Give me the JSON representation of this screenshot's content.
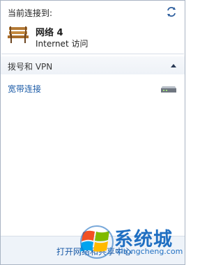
{
  "header": {
    "label": "当前连接到:",
    "refresh_icon": "refresh-icon"
  },
  "current_network": {
    "icon": "park-bench-network-icon",
    "name": "网络  4",
    "status": "Internet 访问"
  },
  "section": {
    "title": "拨号和 VPN",
    "collapse_icon": "chevron-up-icon"
  },
  "connections": [
    {
      "label": "宽带连接",
      "icon": "modem-icon"
    }
  ],
  "footer": {
    "link": "打开网络和共享中心"
  },
  "watermark": {
    "brand": "系统城",
    "url": "xitongcheng.com"
  },
  "colors": {
    "link": "#1a5aa6",
    "border": "#a9b4c3",
    "watermark": "#1f6fc2"
  }
}
